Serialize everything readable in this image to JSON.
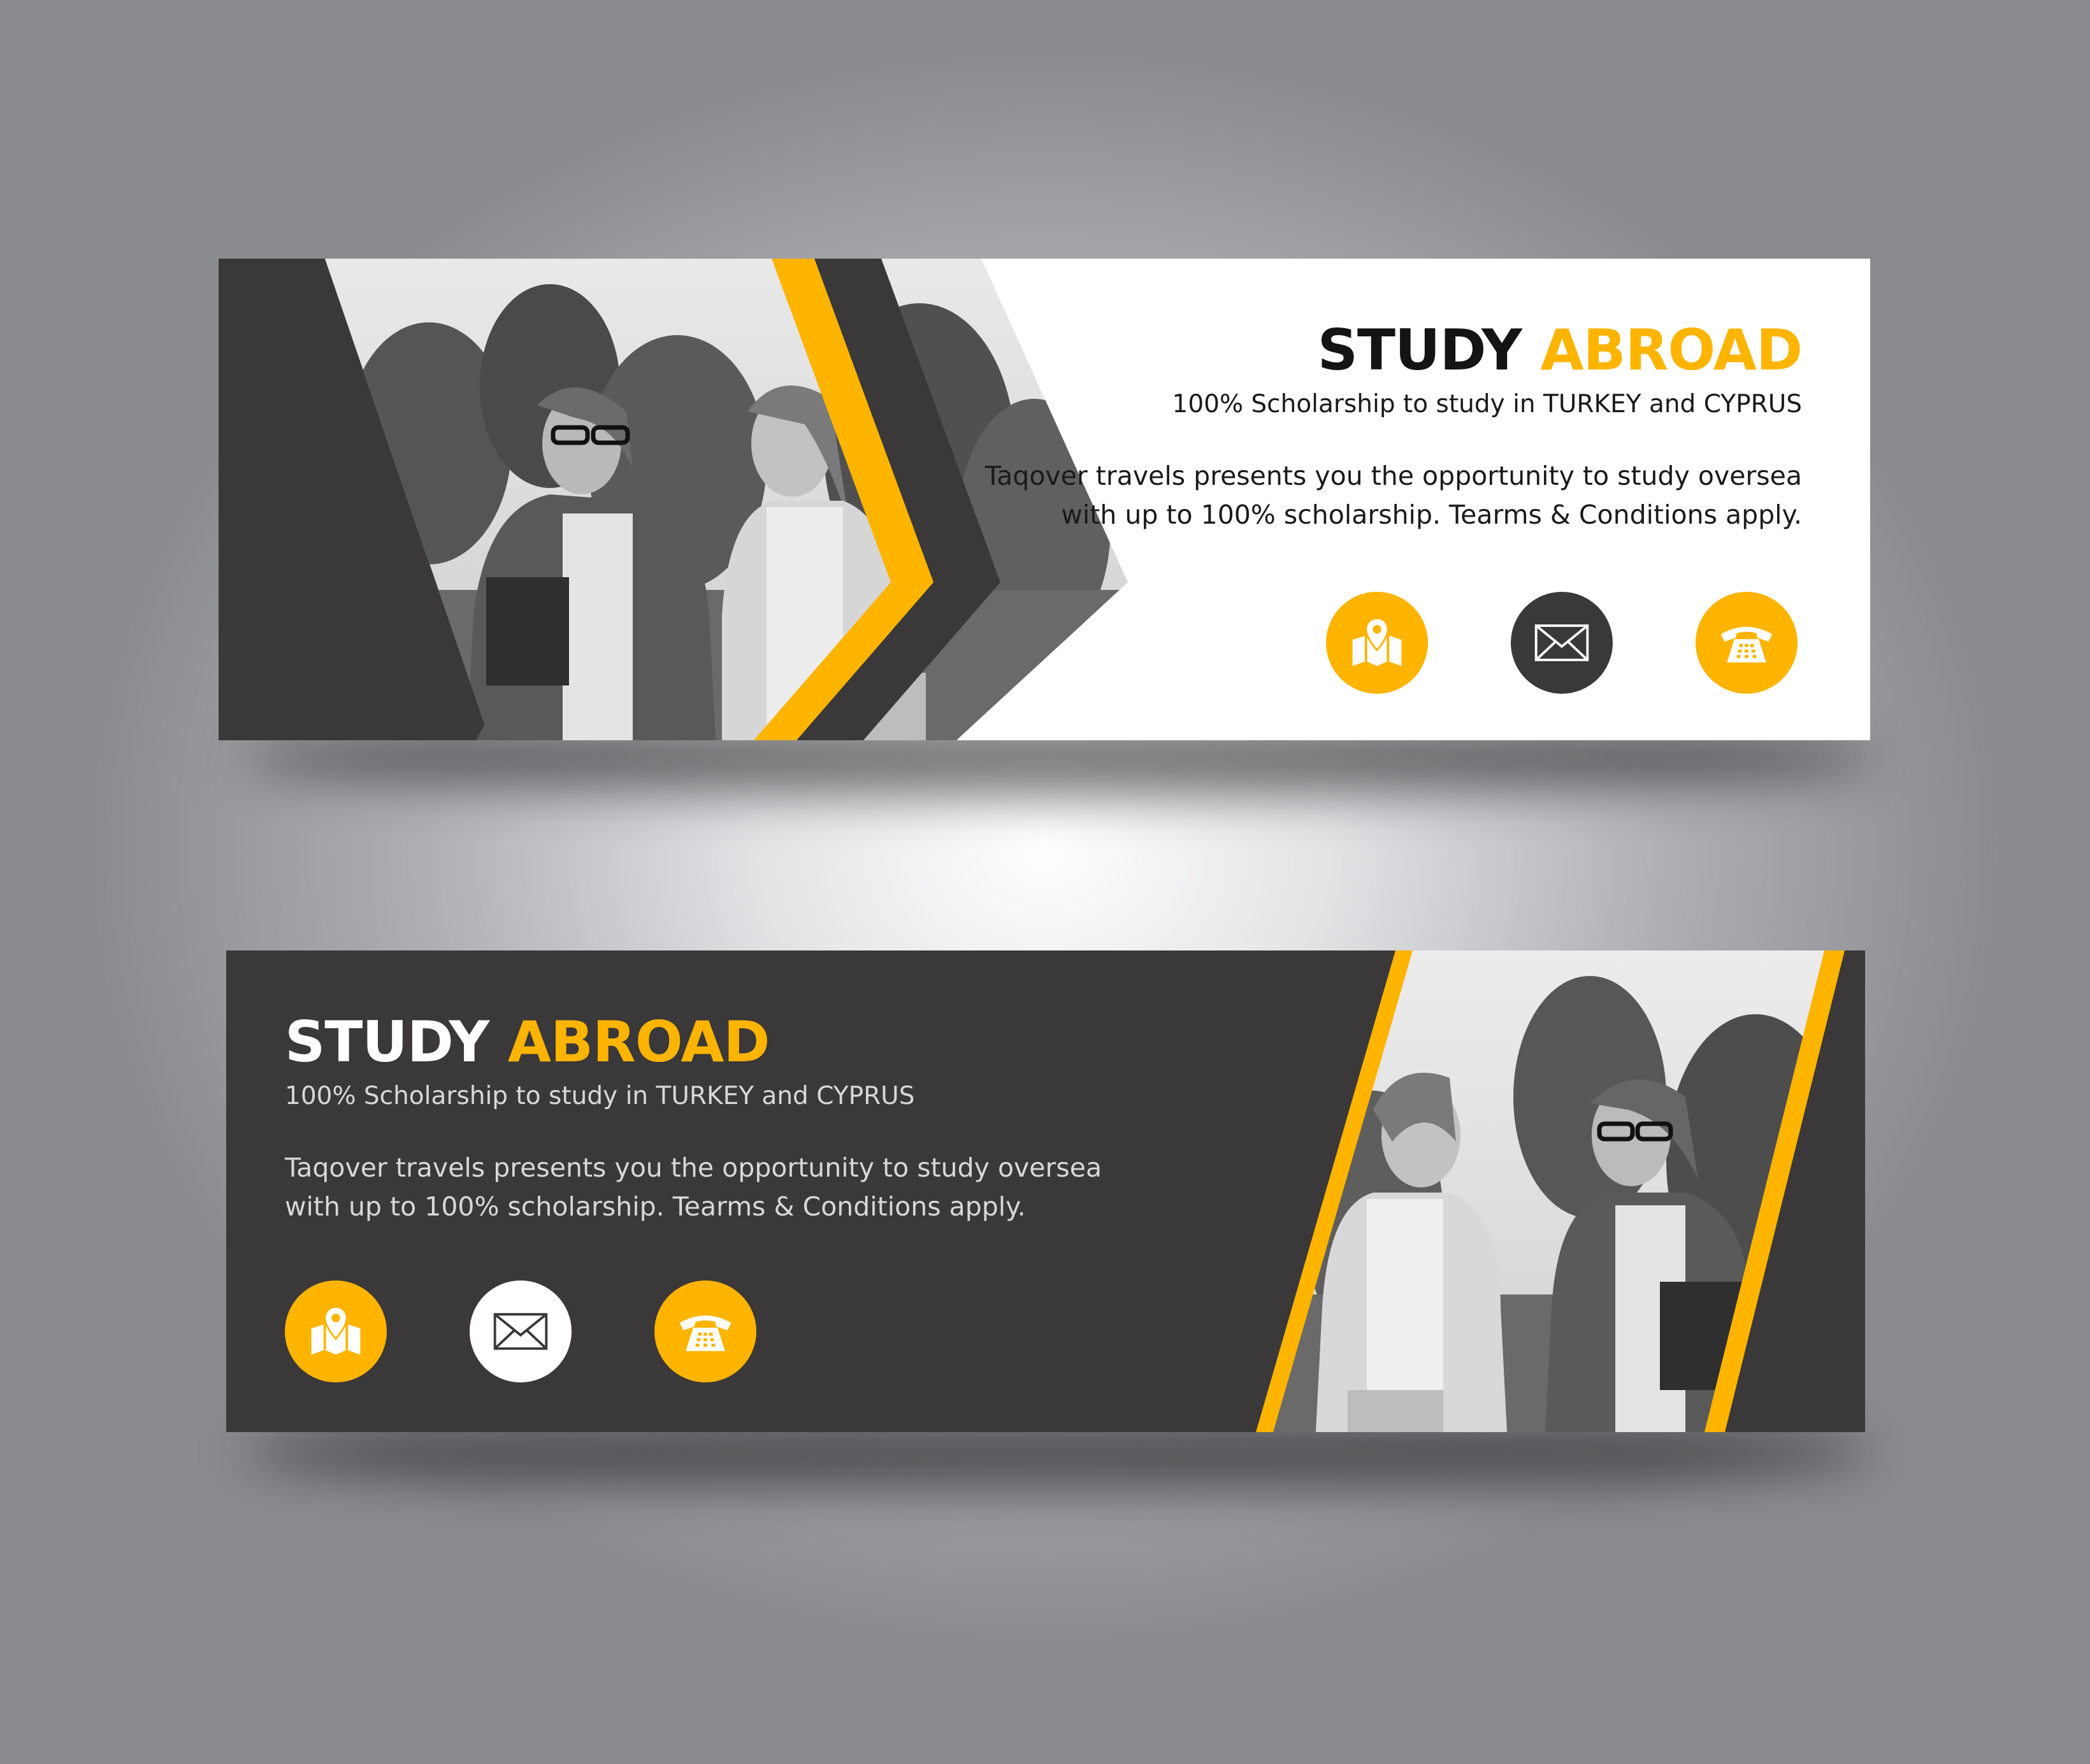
{
  "banners": [
    {
      "theme": "light",
      "title_word1": "STUDY",
      "title_word2": "ABROAD",
      "subtitle": "100% Scholarship to study in TURKEY and CYPRUS",
      "description_line1": "Taqover travels presents you the opportunity to study oversea",
      "description_line2": "with up to 100% scholarship. Tearms & Conditions apply.",
      "icons": [
        "map-pin-icon",
        "envelope-icon",
        "telephone-icon"
      ]
    },
    {
      "theme": "dark",
      "title_word1": "STUDY",
      "title_word2": "ABROAD",
      "subtitle": "100% Scholarship to study in TURKEY and CYPRUS",
      "description_line1": "Taqover travels presents you the opportunity to study oversea",
      "description_line2": "with up to 100% scholarship. Tearms & Conditions apply.",
      "icons": [
        "map-pin-icon",
        "envelope-icon",
        "telephone-icon"
      ]
    }
  ],
  "colors": {
    "accent": "#ffb400",
    "dark": "#3a3839",
    "light": "#ffffff",
    "text_dark": "#1a1a1a",
    "text_light": "#d8d8d8"
  }
}
